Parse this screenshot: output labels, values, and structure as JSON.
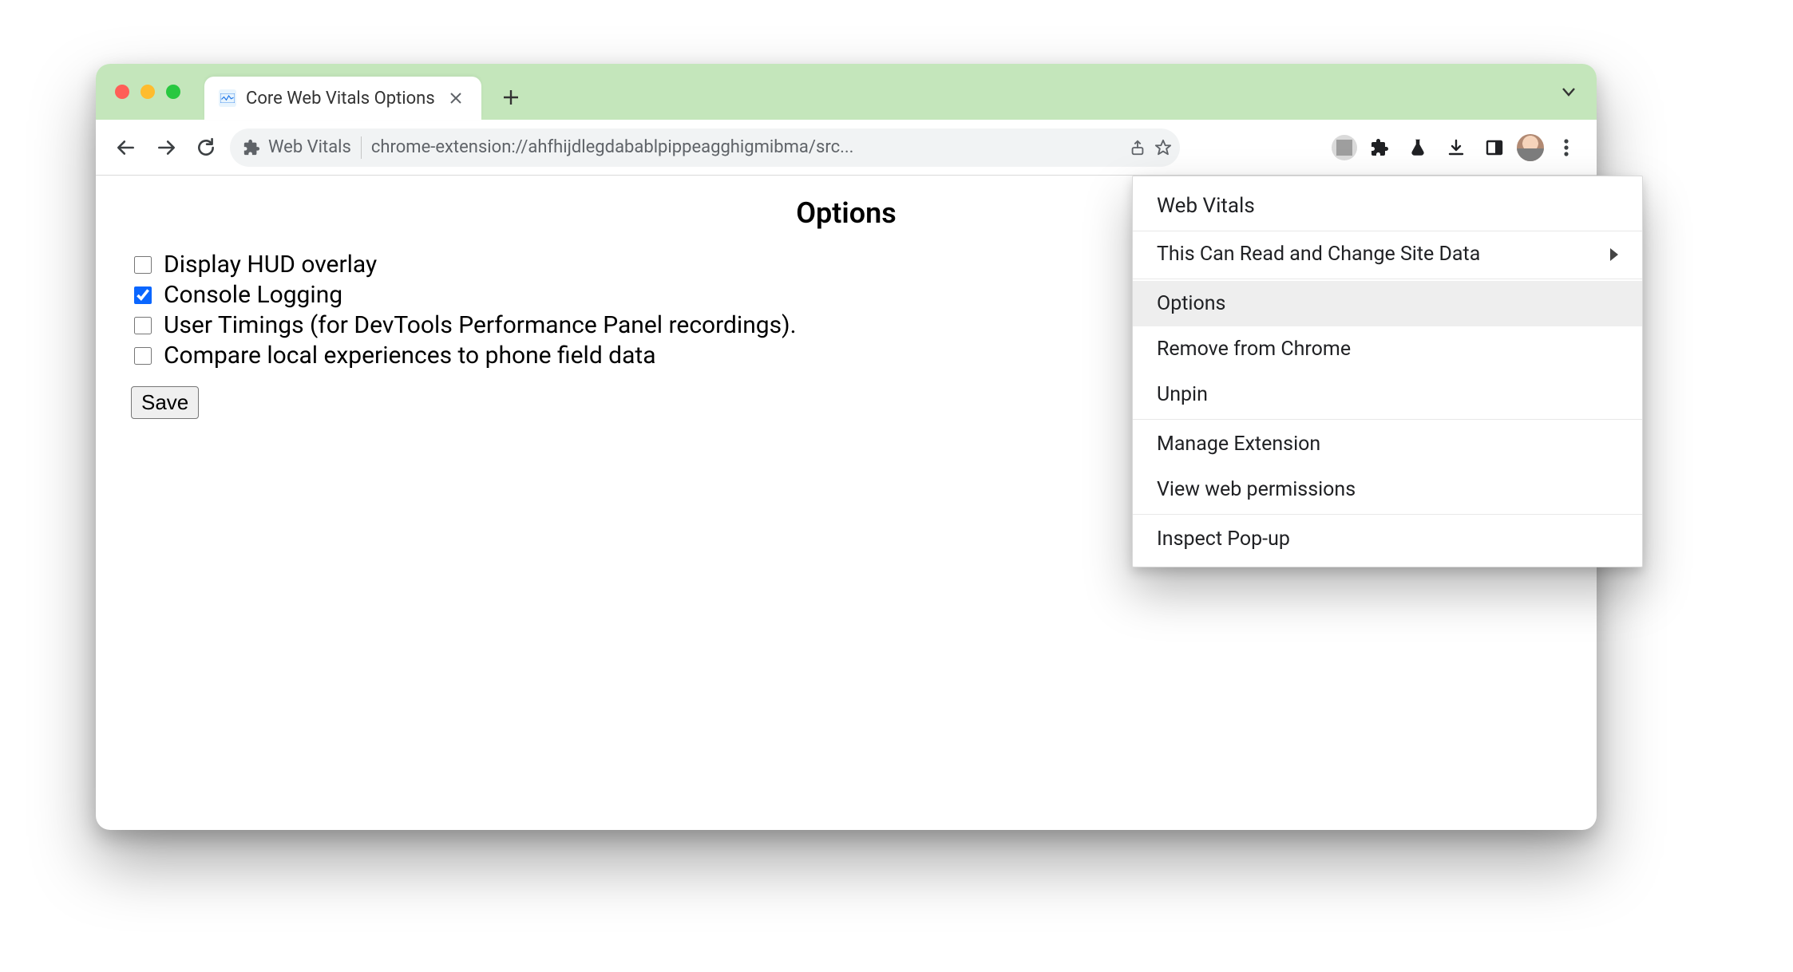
{
  "window": {
    "tab_title": "Core Web Vitals Options"
  },
  "toolbar": {
    "site_label": "Web Vitals",
    "url": "chrome-extension://ahfhijdlegdabablpippeagghigmibma/src..."
  },
  "page": {
    "title": "Options",
    "options": [
      {
        "label": "Display HUD overlay",
        "checked": false
      },
      {
        "label": "Console Logging",
        "checked": true
      },
      {
        "label": "User Timings (for DevTools Performance Panel recordings).",
        "checked": false
      },
      {
        "label": "Compare local experiences to phone field data",
        "checked": false
      }
    ],
    "save_label": "Save"
  },
  "context_menu": {
    "header": "Web Vitals",
    "items": [
      {
        "label": "This Can Read and Change Site Data",
        "submenu": true
      },
      {
        "separator": true
      },
      {
        "label": "Options",
        "highlight": true
      },
      {
        "label": "Remove from Chrome"
      },
      {
        "label": "Unpin"
      },
      {
        "separator": true
      },
      {
        "label": "Manage Extension"
      },
      {
        "label": "View web permissions"
      },
      {
        "separator": true
      },
      {
        "label": "Inspect Pop-up"
      }
    ]
  }
}
